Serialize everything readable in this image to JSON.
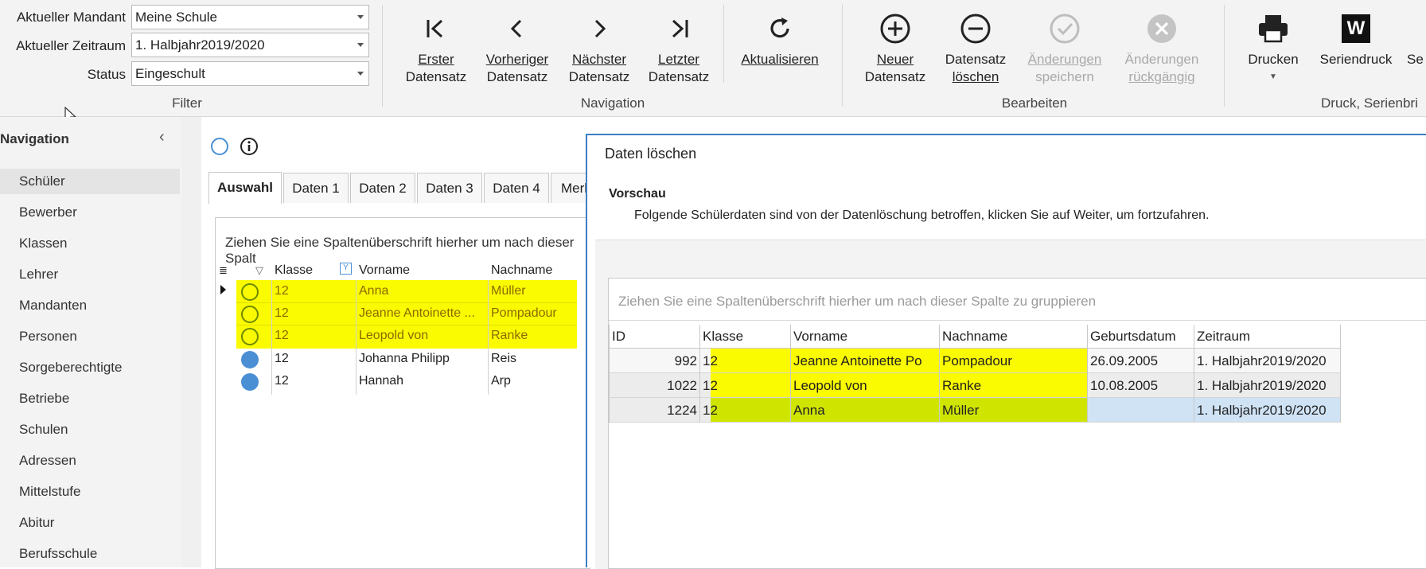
{
  "filter": {
    "mandant_label": "Aktueller Mandant",
    "mandant_value": "Meine Schule",
    "zeitraum_label": "Aktueller Zeitraum",
    "zeitraum_value": "1. Halbjahr2019/2020",
    "status_label": "Status",
    "status_value": "Eingeschult",
    "group_label": "Filter"
  },
  "navigation_group": {
    "label": "Navigation",
    "first_l1": "Erster",
    "first_l2": "Datensatz",
    "prev_l1": "Vorheriger",
    "prev_l2": "Datensatz",
    "next_l1": "Nächster",
    "next_l2": "Datensatz",
    "last_l1": "Letzter",
    "last_l2": "Datensatz",
    "refresh": "Aktualisieren"
  },
  "edit_group": {
    "label": "Bearbeiten",
    "new_l1": "Neuer",
    "new_l2": "Datensatz",
    "delete_l1": "Datensatz",
    "delete_l2": "löschen",
    "save_l1": "Änderungen",
    "save_l2": "speichern",
    "undo_l1": "Änderungen",
    "undo_l2": "rückgängig"
  },
  "print_group": {
    "label": "Druck, Serienbri",
    "print": "Drucken",
    "mail_merge": "Seriendruck",
    "word_letter": "W",
    "more": "Se"
  },
  "sidebar": {
    "title": "Navigation",
    "items": [
      "Schüler",
      "Bewerber",
      "Klassen",
      "Lehrer",
      "Mandanten",
      "Personen",
      "Sorgeberechtigte",
      "Betriebe",
      "Schulen",
      "Adressen",
      "Mittelstufe",
      "Abitur",
      "Berufsschule"
    ]
  },
  "main": {
    "tabs": [
      "Auswahl",
      "Daten 1",
      "Daten 2",
      "Daten 3",
      "Daten 4",
      "Merk"
    ],
    "group_hint": "Ziehen Sie eine Spaltenüberschrift hierher um nach dieser Spalt",
    "columns": [
      "Klasse",
      "Vorname",
      "Nachname"
    ],
    "rows": [
      {
        "klasse": "12",
        "vorname": "Anna",
        "nachname": "Müller"
      },
      {
        "klasse": "12",
        "vorname": "Jeanne Antoinette ...",
        "nachname": "Pompadour"
      },
      {
        "klasse": "12",
        "vorname": "Leopold von",
        "nachname": "Ranke"
      },
      {
        "klasse": "12",
        "vorname": "Johanna Philipp",
        "nachname": "Reis"
      },
      {
        "klasse": "12",
        "vorname": "Hannah",
        "nachname": "Arp"
      }
    ]
  },
  "dialog": {
    "title": "Daten löschen",
    "section": "Vorschau",
    "description": "Folgende Schülerdaten sind von der Datenlöschung betroffen, klicken Sie auf Weiter, um fortzufahren.",
    "group_hint": "Ziehen Sie eine Spaltenüberschrift hierher um nach dieser Spalte zu gruppieren",
    "columns": [
      "ID",
      "Klasse",
      "Vorname",
      "Nachname",
      "Geburtsdatum",
      "Zeitraum"
    ],
    "rows": [
      {
        "id": "992",
        "klasse": "12",
        "vorname": "Jeanne Antoinette Po",
        "nachname": "Pompadour",
        "geburtsdatum": "26.09.2005",
        "zeitraum": "1. Halbjahr2019/2020"
      },
      {
        "id": "1022",
        "klasse": "12",
        "vorname": "Leopold von",
        "nachname": "Ranke",
        "geburtsdatum": "10.08.2005",
        "zeitraum": "1. Halbjahr2019/2020"
      },
      {
        "id": "1224",
        "klasse": "12",
        "vorname": "Anna",
        "nachname": "Müller",
        "geburtsdatum": "",
        "zeitraum": "1. Halbjahr2019/2020"
      }
    ]
  },
  "colors": {
    "highlight": "#fafa00",
    "highlight_selected": "#cfe500",
    "status_blue": "#4a8fd4",
    "dialog_border": "#3c7fc4"
  }
}
